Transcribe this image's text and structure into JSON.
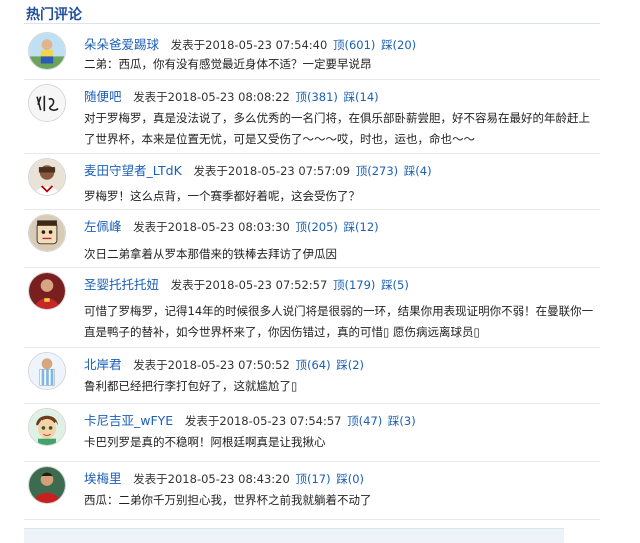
{
  "header": {
    "title": "热门评论"
  },
  "comments": [
    {
      "user": "朵朵爸爱踢球",
      "posted": "发表于2018-05-23 07:54:40",
      "up": "顶(601)",
      "down": "踩(20)",
      "text": "二弟：西瓜，你有没有感觉最近身体不适？一定要早说昂"
    },
    {
      "user": "随便吧",
      "posted": "发表于2018-05-23 08:08:22",
      "up": "顶(381)",
      "down": "踩(14)",
      "text": "对于罗梅罗，真是没法说了，多么优秀的一名门将，在俱乐部卧薪尝胆，好不容易在最好的年龄赶上了世界杯，本来是位置无忧，可是又受伤了～～～哎，时也，运也，命也～～"
    },
    {
      "user": "麦田守望者_LTdK",
      "posted": "发表于2018-05-23 07:57:09",
      "up": "顶(273)",
      "down": "踩(4)",
      "text": "罗梅罗！这么点背，一个赛季都好着呢，这会受伤了？"
    },
    {
      "user": "左佩峰",
      "posted": "发表于2018-05-23 08:03:30",
      "up": "顶(205)",
      "down": "踩(12)",
      "text": "次日二弟拿着从罗本那借来的铁棒去拜访了伊瓜因"
    },
    {
      "user": "圣婴托托托妞",
      "posted": "发表于2018-05-23 07:52:57",
      "up": "顶(179)",
      "down": "踩(5)",
      "text": "可惜了罗梅罗，记得14年的时候很多人说门将是很弱的一环，结果你用表现证明你不弱！在曼联你一直是鸭子的替补，如今世界杯来了，你因伤错过，真的可惜▯ 愿伤病远离球员▯"
    },
    {
      "user": "北岸君",
      "posted": "发表于2018-05-23 07:50:52",
      "up": "顶(64)",
      "down": "踩(2)",
      "text": "鲁利都已经把行李打包好了，这就尴尬了▯"
    },
    {
      "user": "卡尼吉亚_wFYE",
      "posted": "发表于2018-05-23 07:54:57",
      "up": "顶(47)",
      "down": "踩(3)",
      "text": "卡巴列罗是真的不稳啊！阿根廷啊真是让我揪心"
    },
    {
      "user": "埃梅里",
      "posted": "发表于2018-05-23 08:43:20",
      "up": "顶(17)",
      "down": "踩(0)",
      "text": "西瓜：二弟你千万别担心我，世界杯之前我就躺着不动了"
    }
  ],
  "avatar_icons": [
    "player-avatar-icon",
    "handwriting-avatar-icon",
    "portrait-avatar-icon",
    "cartoon-face-avatar-icon",
    "red-jersey-avatar-icon",
    "argentina-kit-avatar-icon",
    "anime-boy-avatar-icon",
    "red-shirt-avatar-icon"
  ]
}
